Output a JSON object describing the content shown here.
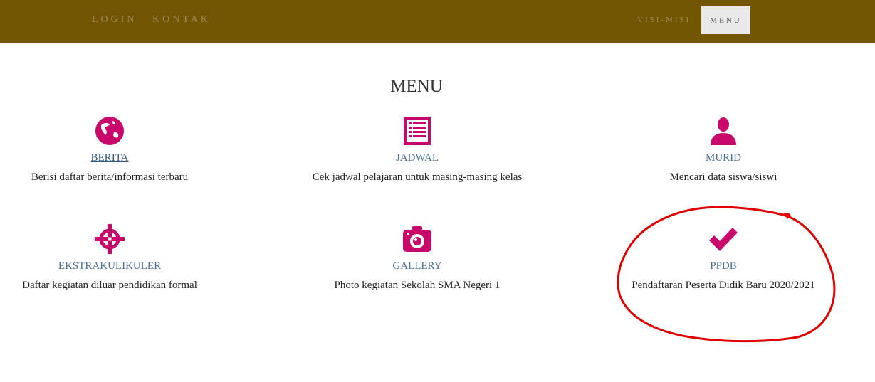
{
  "nav": {
    "left_items": [
      "LOGIN",
      "KONTAK"
    ],
    "visi": "VISI-MISI",
    "menu": "MENU"
  },
  "section": {
    "title": "MENU"
  },
  "cards": [
    {
      "label": "BERITA",
      "desc": "Berisi daftar berita/informasi terbaru",
      "icon": "globe-icon"
    },
    {
      "label": "JADWAL",
      "desc": "Cek jadwal pelajaran untuk masing-masing kelas",
      "icon": "list-icon"
    },
    {
      "label": "MURID",
      "desc": "Mencari data siswa/siswi",
      "icon": "user-icon"
    },
    {
      "label": "EKSTRAKULIKULER",
      "desc": "Daftar kegiatan diluar pendidikan formal",
      "icon": "crosshair-icon"
    },
    {
      "label": "GALLERY",
      "desc": "Photo kegiatan Sekolah SMA Negeri 1",
      "icon": "camera-icon"
    },
    {
      "label": "PPDB",
      "desc": "Pendaftaran Peserta Didik Baru 2020/2021",
      "icon": "checkmark-icon"
    }
  ],
  "colors": {
    "topbar": "#735603",
    "icon": "#c8086b",
    "link": "#4a6f96",
    "annotation": "#e00000"
  }
}
